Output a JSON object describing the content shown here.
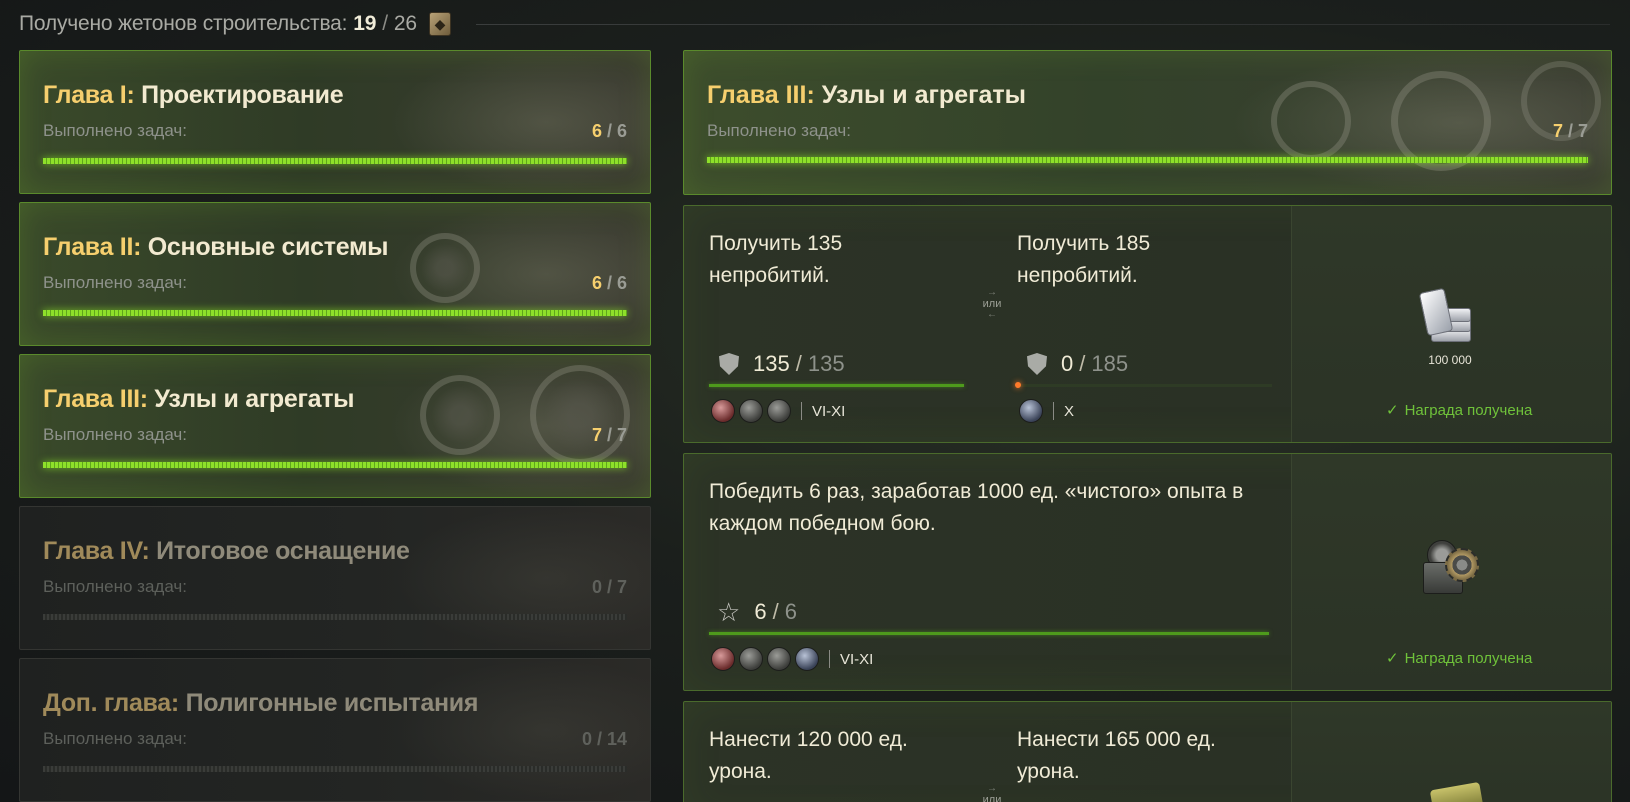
{
  "header": {
    "label": "Получено жетонов строительства:",
    "collected": "19",
    "separator": "/",
    "total": "26"
  },
  "chapters": [
    {
      "prefix": "Глава I:",
      "name": "Проектирование",
      "sub": "Выполнено задач:",
      "done": "6",
      "sep": " / ",
      "total": "6",
      "progress": 1.0,
      "state": "done"
    },
    {
      "prefix": "Глава II:",
      "name": "Основные системы",
      "sub": "Выполнено задач:",
      "done": "6",
      "sep": " / ",
      "total": "6",
      "progress": 1.0,
      "state": "done"
    },
    {
      "prefix": "Глава III:",
      "name": "Узлы и агрегаты",
      "sub": "Выполнено задач:",
      "done": "7",
      "sep": " / ",
      "total": "7",
      "progress": 1.0,
      "state": "done"
    },
    {
      "prefix": "Глава IV:",
      "name": "Итоговое оснащение",
      "sub": "Выполнено задач:",
      "done": "0",
      "sep": " / ",
      "total": "7",
      "progress": 0.0,
      "state": "locked"
    },
    {
      "prefix": "Доп. глава:",
      "name": "Полигонные испытания",
      "sub": "Выполнено задач:",
      "done": "0",
      "sep": " / ",
      "total": "14",
      "progress": 0.0,
      "state": "locked"
    }
  ],
  "detail": {
    "prefix": "Глава III:",
    "name": "Узлы и агрегаты",
    "sub": "Выполнено задач:",
    "done": "7",
    "sep": " / ",
    "total": "7",
    "progress": 1.0
  },
  "tasks": [
    {
      "a": {
        "desc1": "Получить 135",
        "desc2": "непробитий.",
        "cur": "135",
        "slash": "/",
        "max": "135",
        "progress": 1.0,
        "tier": "VI-XI",
        "icons": [
          "red",
          "gray",
          "gray"
        ]
      },
      "or": "или",
      "b": {
        "desc1": "Получить 185",
        "desc2": "непробитий.",
        "cur": "0",
        "slash": "/",
        "max": "185",
        "progress": 0.0,
        "tier": "X",
        "icons": [
          "blue"
        ]
      },
      "reward_amount": "100 000",
      "reward_status": "Награда получена",
      "check": "✓"
    },
    {
      "desc1": "Победить 6 раз, заработав 1000 ед. «чистого» опыта в",
      "desc2": "каждом победном бою.",
      "cur": "6",
      "slash": "/",
      "max": "6",
      "progress": 1.0,
      "tier": "VI-XI",
      "icons": [
        "red",
        "gray",
        "gray",
        "blue"
      ],
      "reward_status": "Награда получена",
      "check": "✓"
    },
    {
      "a": {
        "desc1": "Нанести 120 000 ед.",
        "desc2": "урона."
      },
      "or": "или",
      "b": {
        "desc1": "Нанести 165 000 ед.",
        "desc2": "урона."
      }
    }
  ],
  "icons": {
    "token": "token-icon",
    "shield": "shield-icon",
    "star": "star-icon",
    "vehicle_class": "vehicle-class-icon",
    "silver": "silver-icon",
    "equipment": "equipment-icon"
  },
  "colors": {
    "accent_gold": "#f6cf6e",
    "accent_green": "#8ee02a",
    "status_green": "#6fc23a"
  }
}
